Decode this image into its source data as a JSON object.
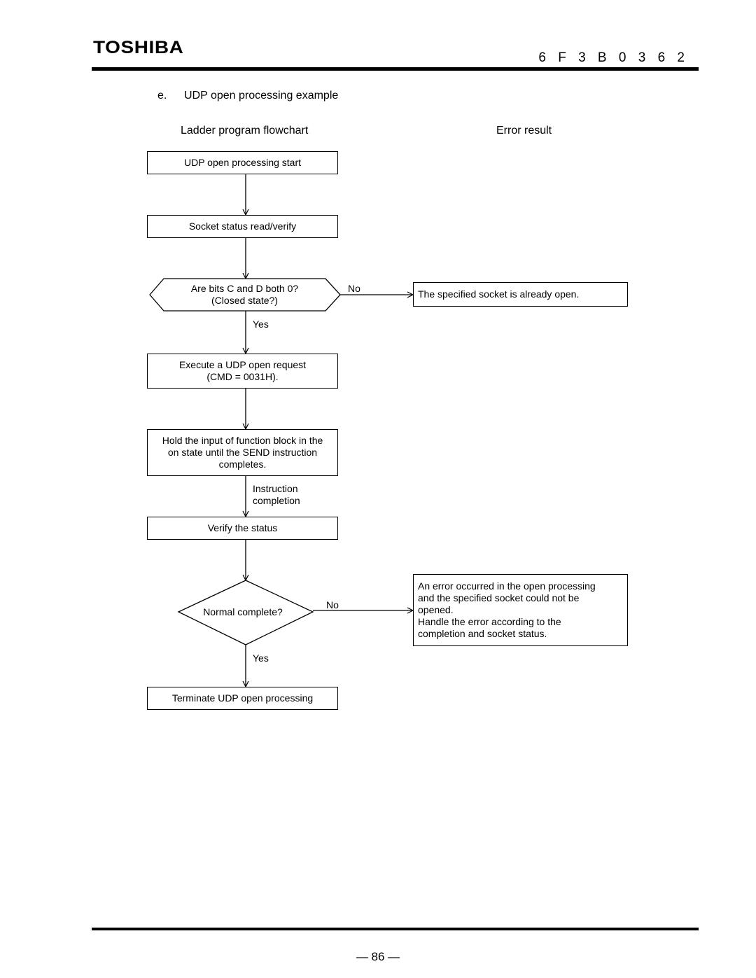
{
  "header": {
    "brand": "TOSHIBA",
    "document_number": "6 F 3 B 0 3 6 2"
  },
  "section": {
    "number": "e.",
    "title": "UDP open processing example"
  },
  "columns": {
    "left": "Ladder program flowchart",
    "right": "Error result"
  },
  "flowchart": {
    "steps": {
      "start": "UDP open processing start",
      "read_status": "Socket status read/verify",
      "decision1_line1": "Are bits C and D both 0?",
      "decision1_line2": "(Closed state?)",
      "execute_line1": "Execute a UDP open request",
      "execute_line2": "(CMD = 0031H).",
      "hold_line1": "Hold the input of function block in the",
      "hold_line2": "on state until the SEND instruction",
      "hold_line3": "completes.",
      "verify": "Verify the status",
      "decision2": "Normal complete?",
      "terminate": "Terminate UDP open processing"
    },
    "edge_labels": {
      "decision1_no": "No",
      "decision1_yes": "Yes",
      "instruction_completion_line1": "Instruction",
      "instruction_completion_line2": "completion",
      "decision2_no": "No",
      "decision2_yes": "Yes"
    },
    "errors": {
      "already_open": "The specified socket is already open.",
      "open_failed_line1": "An error occurred in the open processing",
      "open_failed_line2": "and the specified socket could not be",
      "open_failed_line3": "opened.",
      "open_failed_line4": "Handle the error according to the",
      "open_failed_line5": "completion and socket status."
    }
  },
  "footer": {
    "page_number": "— 86 —"
  }
}
